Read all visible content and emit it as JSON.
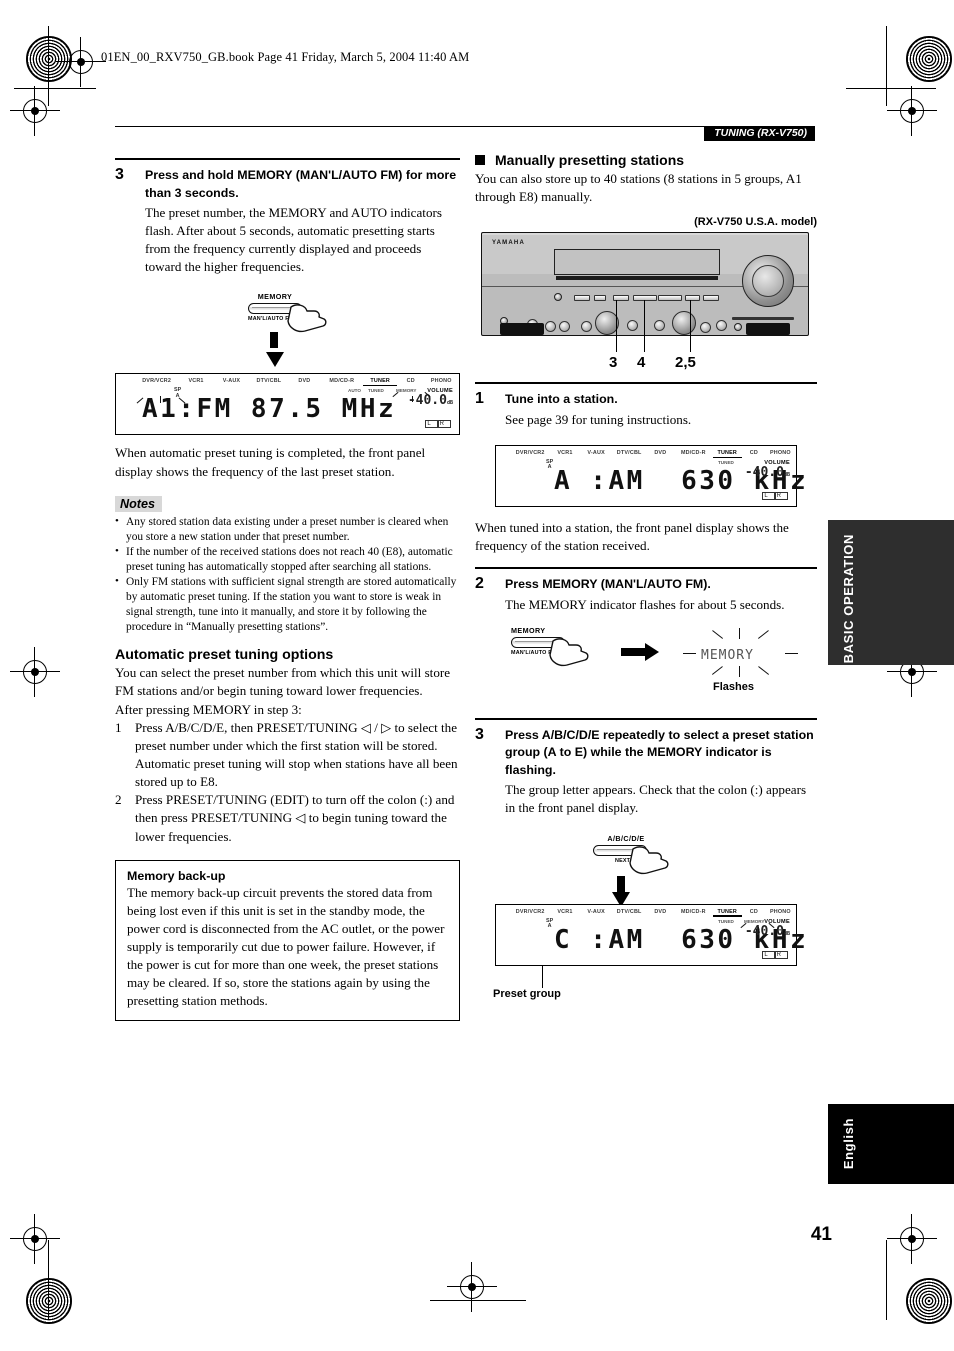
{
  "header": {
    "file_line": "01EN_00_RXV750_GB.book  Page 41  Friday, March 5, 2004  11:40 AM",
    "section_bar": "TUNING (RX-V750)"
  },
  "left_column": {
    "step3": {
      "number": "3",
      "heading": "Press and hold MEMORY (MAN'L/AUTO FM) for more than 3 seconds.",
      "body": "The preset number, the MEMORY and AUTO indicators flash. After about 5 seconds, automatic presetting starts from the frequency currently displayed and proceeds toward the higher frequencies."
    },
    "button_fig": {
      "label": "MEMORY",
      "sublabel": "MAN'L/AUTO FM"
    },
    "display1": {
      "sources": [
        "DVR/VCR2",
        "VCR1",
        "V-AUX",
        "DTV/CBL",
        "DVD",
        "MD/CD-R",
        "TUNER",
        "CD",
        "PHONO"
      ],
      "active_source": "TUNER",
      "sub_indicators": [
        "AUTO",
        "TUNED",
        "MEMORY"
      ],
      "sp_label": "SP",
      "main_text": "A1:FM 87.5 MHz",
      "volume_label": "VOLUME",
      "volume_value": "-40.0",
      "volume_unit": "dB",
      "channel_flags": "L R"
    },
    "after_display_text": "When automatic preset tuning is completed, the front panel display shows the frequency of the last preset station.",
    "notes": {
      "title": "Notes",
      "items": [
        "Any stored station data existing under a preset number is cleared when you store a new station under that preset number.",
        "If the number of the received stations does not reach 40 (E8), automatic preset tuning has automatically stopped after searching all stations.",
        "Only FM stations with sufficient signal strength are stored automatically by automatic preset tuning. If the station you want to store is weak in signal strength, tune into it manually, and store it by following the procedure in “Manually presetting stations”."
      ]
    },
    "options": {
      "heading": "Automatic preset tuning options",
      "intro": "You can select the preset number from which this unit will store FM stations and/or begin tuning toward lower frequencies.",
      "intro2": "After pressing MEMORY in step 3:",
      "items": [
        {
          "n": "1",
          "text": "Press A/B/C/D/E, then PRESET/TUNING ◁ / ▷ to select the preset number under which the first station will be stored. Automatic preset tuning will stop when stations have all been stored up to E8."
        },
        {
          "n": "2",
          "text": "Press PRESET/TUNING (EDIT) to turn off the colon (:) and then press PRESET/TUNING ◁ to begin tuning toward the lower frequencies."
        }
      ]
    },
    "memory_backup": {
      "heading": "Memory back-up",
      "body": "The memory back-up circuit prevents the stored data from being lost even if this unit is set in the standby mode, the power cord is disconnected from the AC outlet, or the power supply is temporarily cut due to power failure. However, if the power is cut for more than one week, the preset stations may be cleared. If so, store the stations again by using the presetting station methods."
    }
  },
  "right_column": {
    "section": {
      "heading": "Manually presetting stations",
      "body": "You can also store up to 40 stations (8 stations in 5 groups, A1 through E8) manually."
    },
    "model_tag": "(RX-V750 U.S.A. model)",
    "receiver": {
      "brand": "YAMAHA",
      "callouts": [
        "3",
        "4",
        "2,5"
      ]
    },
    "step1": {
      "number": "1",
      "heading": "Tune into a station.",
      "body": "See page 39 for tuning instructions."
    },
    "display2": {
      "sources": [
        "DVR/VCR2",
        "VCR1",
        "V-AUX",
        "DTV/CBL",
        "DVD",
        "MD/CD-R",
        "TUNER",
        "CD",
        "PHONO"
      ],
      "active_source": "TUNER",
      "sub_indicators": [
        "TUNED"
      ],
      "sp_label": "SP",
      "main_text": "A :AM  630 kHz",
      "volume_label": "VOLUME",
      "volume_value": "-40.0",
      "volume_unit": "dB",
      "channel_flags": "L R"
    },
    "after_display2_text": "When tuned into a station, the front panel display shows the frequency of the station received.",
    "step2": {
      "number": "2",
      "heading": "Press MEMORY (MAN'L/AUTO FM).",
      "body": "The MEMORY indicator flashes for about 5 seconds.",
      "button_label": "MEMORY",
      "button_sublabel": "MAN'L/AUTO FM",
      "flash_word": "MEMORY",
      "flash_caption": "Flashes"
    },
    "step3": {
      "number": "3",
      "heading": "Press A/B/C/D/E repeatedly to select a preset station group (A to E) while the MEMORY indicator is flashing.",
      "body": "The group letter appears. Check that the colon (:) appears in the front panel display.",
      "button_label": "A/B/C/D/E",
      "button_sublabel": "NEXT"
    },
    "display3": {
      "sources": [
        "DVR/VCR2",
        "VCR1",
        "V-AUX",
        "DTV/CBL",
        "DVD",
        "MD/CD-R",
        "TUNER",
        "CD",
        "PHONO"
      ],
      "active_source": "TUNER",
      "sub_indicators": [
        "TUNED",
        "MEMORY"
      ],
      "sp_label": "SP",
      "main_text": "C :AM  630 kHz",
      "volume_label": "VOLUME",
      "volume_value": "-40.0",
      "volume_unit": "dB",
      "channel_flags": "L R",
      "caption": "Preset group"
    }
  },
  "tabs": {
    "basic_operation": "BASIC OPERATION",
    "english": "English"
  },
  "page_number": "41"
}
